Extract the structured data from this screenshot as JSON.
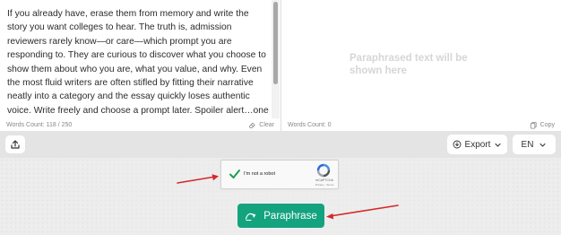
{
  "editor": {
    "input_text": "If you already have, erase them from memory and write the story you want colleges to hear. The truth is, admission reviewers rarely know—or care—which prompt you are responding to. They are curious to discover what you choose to show them about who you are, what you value, and why. Even the most fluid writers are often stifled by fitting their narrative neatly into a category and the essay quickly loses authentic voice. Write freely and choose a prompt later. Spoiler alert…one prompt is “Share an essay on any topic of your choice. It can be one you’ve already written, one that responds",
    "input_word_count": "Words Count: 118 / 250",
    "clear_label": "Clear",
    "output_placeholder": "Paraphrased text will be shown here",
    "output_word_count": "Words Count: 0",
    "copy_label": "Copy"
  },
  "toolbar": {
    "share_icon": "share-icon",
    "export_label": "Export",
    "language_label": "EN"
  },
  "recaptcha": {
    "label": "I'm not a robot",
    "brand": "reCAPTCHA",
    "terms": "Privacy - Terms"
  },
  "action": {
    "paraphrase_label": "Paraphrase"
  },
  "colors": {
    "accent": "#14a37f",
    "annotation_arrow": "#d62828"
  }
}
